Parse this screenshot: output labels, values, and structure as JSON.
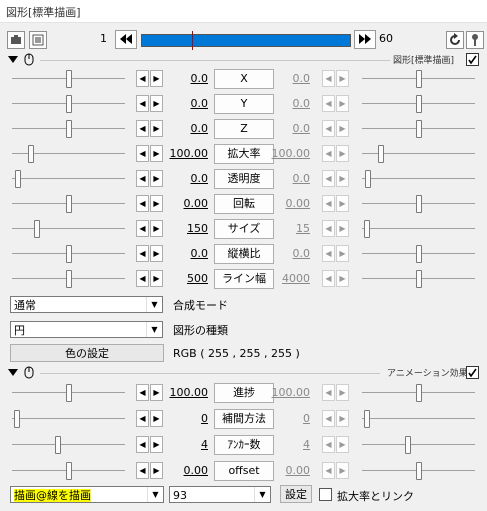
{
  "window": {
    "title": "図形[標準描画]"
  },
  "timeline": {
    "start": "1",
    "end": "60"
  },
  "section1": {
    "label": "図形[標準描画]",
    "checked": true
  },
  "params": [
    {
      "name": "X",
      "left": "0.0",
      "right": "0.0",
      "lpos": 0.5,
      "rpos": 0.5
    },
    {
      "name": "Y",
      "left": "0.0",
      "right": "0.0",
      "lpos": 0.5,
      "rpos": 0.5
    },
    {
      "name": "Z",
      "left": "0.0",
      "right": "0.0",
      "lpos": 0.5,
      "rpos": 0.5
    },
    {
      "name": "拡大率",
      "left": "100.00",
      "right": "100.00",
      "lpos": 0.15,
      "rpos": 0.15
    },
    {
      "name": "透明度",
      "left": "0.0",
      "right": "0.0",
      "lpos": 0.03,
      "rpos": 0.03
    },
    {
      "name": "回転",
      "left": "0.00",
      "right": "0.00",
      "lpos": 0.5,
      "rpos": 0.5
    },
    {
      "name": "サイズ",
      "left": "150",
      "right": "15",
      "lpos": 0.2,
      "rpos": 0.02
    },
    {
      "name": "縦横比",
      "left": "0.0",
      "right": "0.0",
      "lpos": 0.5,
      "rpos": 0.5
    },
    {
      "name": "ライン幅",
      "left": "500",
      "right": "4000",
      "lpos": 0.5,
      "rpos": 0.5
    }
  ],
  "blend": {
    "value": "通常",
    "label": "合成モード"
  },
  "shape": {
    "value": "円",
    "label": "図形の種類"
  },
  "color": {
    "button": "色の設定",
    "value": "RGB ( 255 , 255 , 255 )"
  },
  "section2": {
    "label": "アニメーション効果",
    "checked": true
  },
  "anim_params": [
    {
      "name": "進捗",
      "left": "100.00",
      "right": "100.00",
      "lpos": 0.5,
      "rpos": 0.5
    },
    {
      "name": "補間方法",
      "left": "0",
      "right": "0",
      "lpos": 0.02,
      "rpos": 0.02
    },
    {
      "name": "ｱﾝｶｰ数",
      "left": "4",
      "right": "4",
      "lpos": 0.4,
      "rpos": 0.4
    },
    {
      "name": "offset",
      "left": "0.00",
      "right": "0.00",
      "lpos": 0.5,
      "rpos": 0.5
    }
  ],
  "footer": {
    "effect": "描画@線を描画",
    "effect_value": "93",
    "settings_button": "設定",
    "link_label": "拡大率とリンク",
    "link_checked": false
  },
  "colors": {
    "timeline_bar": "#0078d7",
    "timeline_marker": "#c00000",
    "highlight": "#ffff00"
  }
}
